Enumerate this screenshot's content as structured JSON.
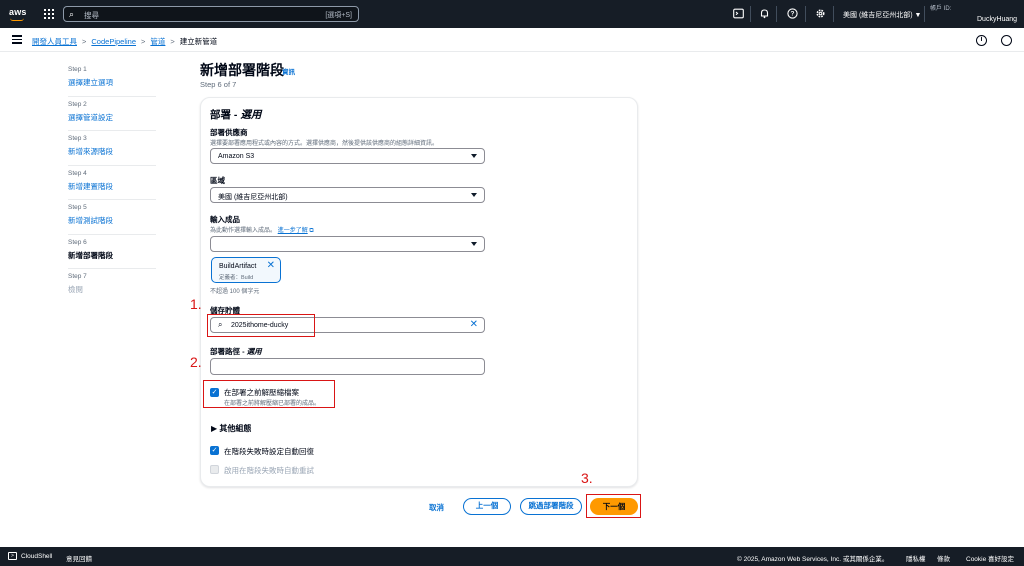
{
  "topbar": {
    "logo": "aws",
    "search_placeholder": "搜尋",
    "search_shortcut": "[選項+S]",
    "region": "美國 (維吉尼亞州北部) ▼",
    "account_id_label": "帳戶 ID:",
    "account_name": "DuckyHuang",
    "icons": [
      "cloudshell-icon",
      "bell-icon",
      "help-icon",
      "gear-icon"
    ]
  },
  "breadcrumb": {
    "items": [
      "開發人員工具",
      "CodePipeline",
      "管道"
    ],
    "current": "建立新管道"
  },
  "steps": [
    {
      "num": "Step 1",
      "label": "選擇建立選項"
    },
    {
      "num": "Step 2",
      "label": "選擇管道設定"
    },
    {
      "num": "Step 3",
      "label": "新增來源階段"
    },
    {
      "num": "Step 4",
      "label": "新增建置階段"
    },
    {
      "num": "Step 5",
      "label": "新增測試階段"
    },
    {
      "num": "Step 6",
      "label": "新增部署階段"
    },
    {
      "num": "Step 7",
      "label": "檢閱"
    }
  ],
  "header": {
    "title": "新增部署階段",
    "info": "資訊",
    "step_of": "Step 6 of 7"
  },
  "panel": {
    "title_main": "部署 - ",
    "title_optional": "選用",
    "provider": {
      "label": "部署供應商",
      "desc": "選擇要部署應用程式或內容的方式。選擇供應商，然後提供該供應商的組態詳細資訊。",
      "value": "Amazon S3"
    },
    "region": {
      "label": "區域",
      "value": "美國 (維吉尼亞州北部)"
    },
    "artifacts": {
      "label": "輸入成品",
      "desc": "為此動作選擇輸入成品。",
      "learn_more": "進一步了解",
      "token_name": "BuildArtifact",
      "token_desc": "定義者：Build",
      "limit": "不超過 100 個字元"
    },
    "bucket": {
      "label": "儲存貯體",
      "value": "2025ithome-ducky"
    },
    "path": {
      "label_main": "部署路徑 - ",
      "label_optional": "選用"
    },
    "extract": {
      "label": "在部署之前解壓縮檔案",
      "desc": "在部署之前將解壓縮已部署的成品。"
    },
    "other_config": "其他組態",
    "rollback": "在階段失敗時設定自動回復",
    "retry": "啟用在階段失敗時自動重試"
  },
  "annotations": [
    "1.",
    "2.",
    "3."
  ],
  "buttons": {
    "cancel": "取消",
    "previous": "上一個",
    "skip": "跳過部署階段",
    "next": "下一個"
  },
  "footer": {
    "cloudshell": "CloudShell",
    "feedback": "意見回饋",
    "copyright": "© 2025, Amazon Web Services, Inc. 或其關係企業。",
    "privacy": "隱私權",
    "terms": "條款",
    "cookies": "Cookie 喜好設定"
  }
}
